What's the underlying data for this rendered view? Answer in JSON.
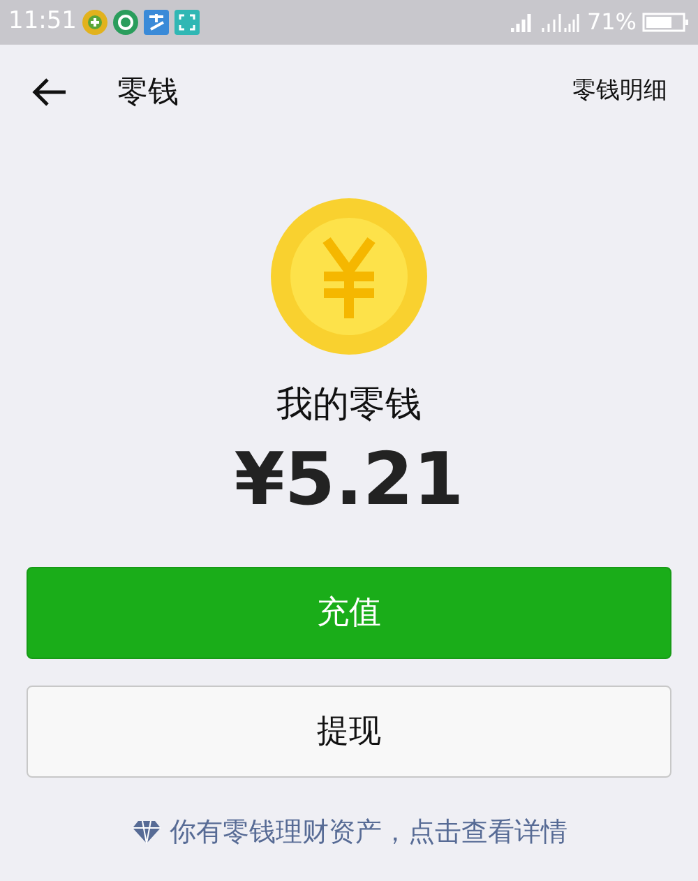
{
  "status_bar": {
    "time": "11:51",
    "battery": "71%"
  },
  "header": {
    "title": "零钱",
    "action": "零钱明细"
  },
  "balance": {
    "label": "我的零钱",
    "amount": "¥5.21"
  },
  "buttons": [
    {
      "label": "充值",
      "kind": "primary"
    },
    {
      "label": "提现",
      "kind": "secondary"
    }
  ],
  "footer_link": "你有零钱理财资产，点击查看详情"
}
